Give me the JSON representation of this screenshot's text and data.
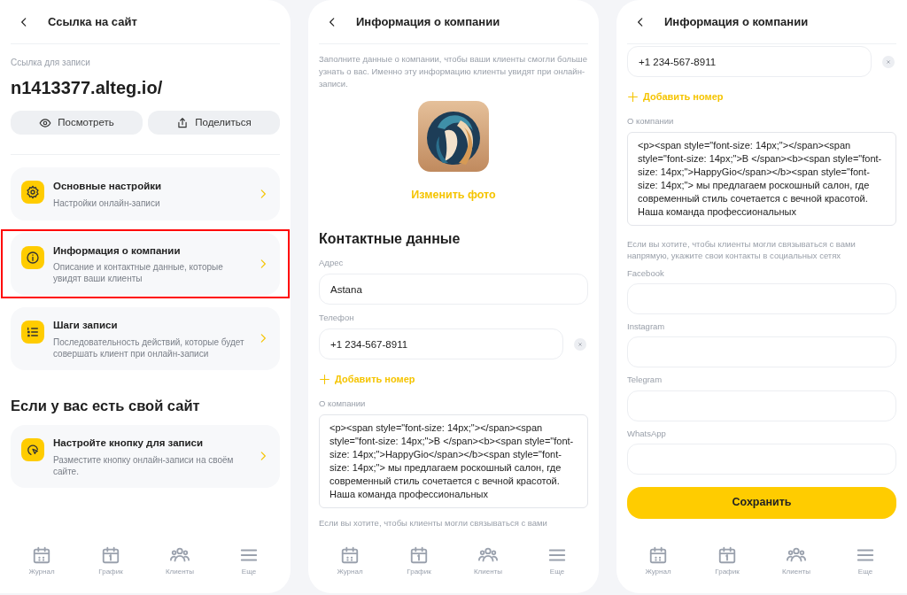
{
  "link_screen": {
    "title": "Ссылка на сайт",
    "link_label": "Ссылка для записи",
    "link": "n1413377.alteg.io/",
    "buttons": [
      {
        "label": "Посмотреть"
      },
      {
        "label": "Поделиться"
      }
    ],
    "menu": [
      {
        "title": "Основные настройки",
        "subtitle": "Настройки онлайн-записи",
        "highlighted": false
      },
      {
        "title": "Информация о компании",
        "subtitle": "Описание и контактные данные, которые увидят ваши клиенты",
        "highlighted": true
      },
      {
        "title": "Шаги записи",
        "subtitle": "Последовательность действий, которые будет совершать клиент при онлайн-записи",
        "highlighted": false
      }
    ],
    "section_title": "Если у вас есть свой сайт",
    "site_menu": [
      {
        "title": "Настройте кнопку для записи",
        "subtitle": "Разместите кнопку онлайн-записи на своём сайте.",
        "highlighted": false
      }
    ],
    "nav": [
      {
        "label": "Журнал"
      },
      {
        "label": "График"
      },
      {
        "label": "Клиенты"
      },
      {
        "label": "Еще"
      }
    ]
  },
  "company_screen": {
    "title": "Информация о компании",
    "intro": "Заполните данные о компании, чтобы ваши клиенты смогли больше узнать о вас. Именно эту информацию клиенты увидят при онлайн-записи.",
    "change_photo": "Изменить фото",
    "section_title": "Контактные данные",
    "fields": [
      {
        "label": "Адрес",
        "value": "Astana",
        "removable": false
      },
      {
        "label": "Телефон",
        "value": "+1 234-567-8911",
        "removable": true
      }
    ],
    "add_phone": "Добавить номер",
    "about": {
      "label": "О компании",
      "value": "<p><span style=\"font-size: 14px;\"></span><span style=\"font-size: 14px;\">В </span><b><span style=\"font-size: 14px;\">HappyGio</span></b><span style=\"font-size: 14px;\"> мы предлагаем роскошный салон, где современный стиль сочетается с вечной красотой. Наша команда профессиональных"
    },
    "social_note": "Если вы хотите, чтобы клиенты могли связываться с вами",
    "nav": [
      {
        "label": "Журнал"
      },
      {
        "label": "График"
      },
      {
        "label": "Клиенты"
      },
      {
        "label": "Еще"
      }
    ]
  },
  "company_screen_scrolled": {
    "title": "Информация о компании",
    "phone": {
      "value": "+1 234-567-8911",
      "removable": true
    },
    "add_phone": "Добавить номер",
    "about": {
      "label": "О компании",
      "value": "<p><span style=\"font-size: 14px;\"></span><span style=\"font-size: 14px;\">В </span><b><span style=\"font-size: 14px;\">HappyGio</span></b><span style=\"font-size: 14px;\"> мы предлагаем роскошный салон, где современный стиль сочетается с вечной красотой. Наша команда профессиональных"
    },
    "social_note": "Если вы хотите, чтобы клиенты могли связываться с вами напрямую, укажите свои контакты в социальных сетях",
    "socials": [
      {
        "label": "Facebook"
      },
      {
        "label": "Instagram"
      },
      {
        "label": "Telegram"
      },
      {
        "label": "WhatsApp"
      }
    ],
    "save_button": "Сохранить",
    "nav": [
      {
        "label": "Журнал"
      },
      {
        "label": "График"
      },
      {
        "label": "Клиенты"
      },
      {
        "label": "Еще"
      }
    ]
  }
}
